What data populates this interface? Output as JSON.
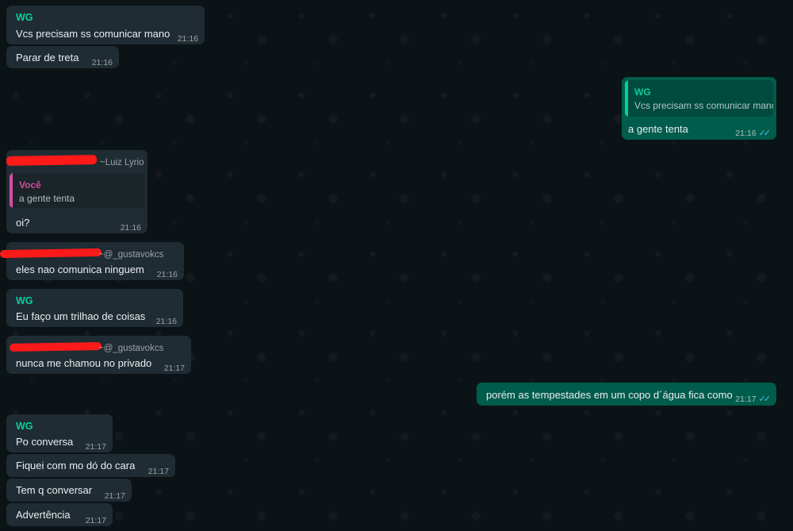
{
  "colors": {
    "incoming_bubble": "#202c33",
    "outgoing_bubble": "#005c4b",
    "sender_green": "#06cf9c",
    "you_pink": "#d44c9f",
    "read_ticks": "#53bdeb",
    "redaction": "#ff1a1a"
  },
  "icons": {
    "read_receipt": "double-check-icon"
  },
  "messages": [
    {
      "sender": "WG",
      "text": "Vcs precisam ss comunicar mano",
      "time": "21:16"
    },
    {
      "text": "Parar de treta",
      "time": "21:16"
    },
    {
      "quote_sender": "WG",
      "quote_text": "Vcs precisam ss comunicar mano",
      "text": "a gente tenta",
      "time": "21:16",
      "ticks": "✓✓"
    },
    {
      "handle": "~Luiz Lyrio",
      "quote_sender": "Você",
      "quote_text": "a gente tenta",
      "text": "oi?",
      "time": "21:16"
    },
    {
      "handle": "~@_gustavokcs",
      "text": "eles nao comunica ninguem",
      "time": "21:16"
    },
    {
      "sender": "WG",
      "text": "Eu faço um trilhao de coisas",
      "time": "21:16"
    },
    {
      "handle": "~@_gustavokcs",
      "text": "nunca me chamou no privado",
      "time": "21:17"
    },
    {
      "text": "porém as tempestades em um copo d´água fica como",
      "time": "21:17",
      "ticks": "✓✓"
    },
    {
      "sender": "WG",
      "text": "Po conversa",
      "time": "21:17"
    },
    {
      "text": "Fiquei com mo dó do cara",
      "time": "21:17"
    },
    {
      "text": "Tem q conversar",
      "time": "21:17"
    },
    {
      "text": "Advertência",
      "time": "21:17"
    }
  ]
}
